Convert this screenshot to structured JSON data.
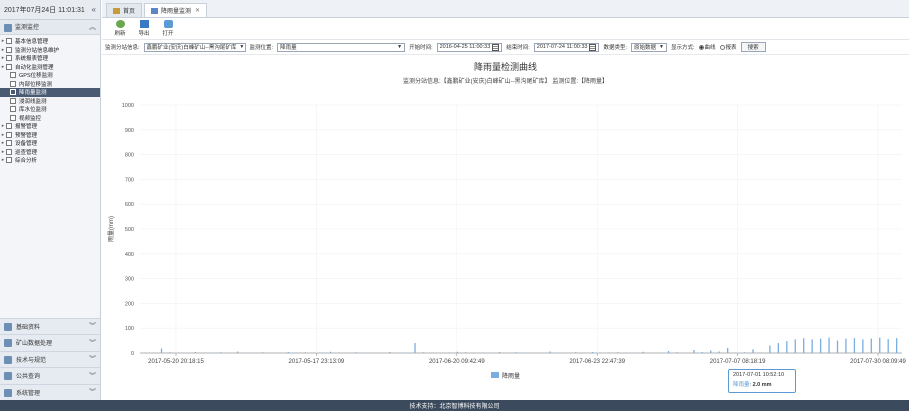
{
  "sidebar": {
    "datetime": "2017年07月24日 11:01:31",
    "collapse_icon": "double-chevron-left-icon",
    "section": "监测监控",
    "tree": [
      {
        "label": "基本信息管理",
        "level": 0,
        "expandable": true
      },
      {
        "label": "监测分站信息维护",
        "level": 0,
        "expandable": true
      },
      {
        "label": "系统报表管理",
        "level": 0,
        "expandable": true
      },
      {
        "label": "自动化监测管理",
        "level": 0,
        "expandable": true
      },
      {
        "label": "GPS位移监测",
        "level": 1
      },
      {
        "label": "内部位移监测",
        "level": 1
      },
      {
        "label": "降雨量监测",
        "level": 1,
        "selected": true
      },
      {
        "label": "浸润线监测",
        "level": 1
      },
      {
        "label": "库水位监测",
        "level": 1
      },
      {
        "label": "视频监控",
        "level": 1
      },
      {
        "label": "报警管理",
        "level": 0,
        "expandable": true
      },
      {
        "label": "预警管理",
        "level": 0,
        "expandable": true
      },
      {
        "label": "设备管理",
        "level": 0,
        "expandable": true
      },
      {
        "label": "巡查管理",
        "level": 0,
        "expandable": true
      },
      {
        "label": "综合分析",
        "level": 0,
        "expandable": true
      }
    ],
    "bottom_menu": [
      "基础资料",
      "矿山数据处理",
      "技术与规范",
      "公共查询",
      "系统管理"
    ]
  },
  "tabs": [
    {
      "label": "首页",
      "active": false
    },
    {
      "label": "降雨量监测",
      "active": true
    }
  ],
  "toolbar": {
    "refresh": "刷新",
    "export": "导出",
    "open": "打开"
  },
  "filters": {
    "station_label": "监测分站信息:",
    "station_value": "鑫鹏矿业(安庆)白峰矿山--黑沟尾矿库",
    "point_label": "监测位置:",
    "point_value": "降雨量",
    "start_label": "开始时间:",
    "start_value": "2016-04-25 11:00:33",
    "end_label": "结束时间:",
    "end_value": "2017-07-24 11:00:33",
    "type_label": "数据类型:",
    "type_value": "原始数据",
    "mode_label": "显示方式:",
    "mode_options": [
      "曲线",
      "报表"
    ],
    "mode_selected": "曲线",
    "search": "搜索"
  },
  "chart_data": {
    "type": "bar",
    "title": "降雨量检测曲线",
    "subtitle": "监测分站信息:【鑫鹏矿业(安庆)白峰矿山--黑沟尾矿库】 监测位置:【降雨量】",
    "ylabel": "雨量(mm)",
    "ylim": [
      0,
      1000
    ],
    "yticks": [
      0,
      100,
      200,
      300,
      400,
      500,
      600,
      700,
      800,
      900,
      1000
    ],
    "xtick_labels": [
      "2017-05-20 20:18:15",
      "2017-05-17 23:13:09",
      "2017-06-20 09:42:49",
      "2017-06-23 22:47:39",
      "2017-07-07 08:18:19",
      "2017-07-30 08:09:49"
    ],
    "series": [
      {
        "name": "降雨量",
        "color": "#7aaee0"
      }
    ],
    "approx_values": [
      2,
      1,
      18,
      3,
      2,
      1,
      4,
      2,
      1,
      3,
      2,
      6,
      1,
      2,
      3,
      1,
      2,
      4,
      1,
      3,
      2,
      1,
      5,
      2,
      1,
      3,
      2,
      1,
      2,
      4,
      1,
      2,
      40,
      3,
      2,
      1,
      2,
      5,
      3,
      1,
      2,
      2,
      4,
      1,
      3,
      2,
      1,
      2,
      6,
      2,
      1,
      3,
      2,
      4,
      1,
      2,
      3,
      1,
      2,
      5,
      2,
      1,
      8,
      3,
      2,
      12,
      4,
      10,
      6,
      20,
      2,
      3,
      15,
      2,
      30,
      40,
      48,
      55,
      60,
      55,
      58,
      62,
      50,
      58,
      60,
      55,
      58,
      62,
      56,
      60
    ],
    "legend": "bottom-center"
  },
  "tooltip": {
    "time": "2017-07-01 10:52:10",
    "series": "降雨量",
    "value": "2.0 mm"
  },
  "footer": "技术支持：北京智博科技有限公司"
}
